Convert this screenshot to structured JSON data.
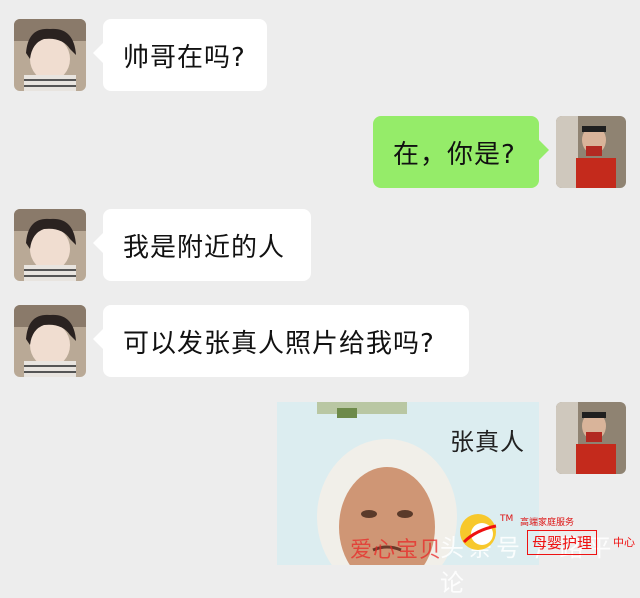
{
  "messages": [
    {
      "sender": "contact",
      "text": "帅哥在吗?"
    },
    {
      "sender": "self",
      "text": "在，你是?"
    },
    {
      "sender": "contact",
      "text": "我是附近的人"
    },
    {
      "sender": "contact",
      "text": "可以发张真人照片给我吗?"
    },
    {
      "sender": "self",
      "type": "sticker",
      "caption": "张真人"
    }
  ],
  "watermark": {
    "tm": "TM",
    "service": "高端家庭服务",
    "brand": "爱心宝贝",
    "center": "母婴护理",
    "suffix": "中心"
  },
  "overlay": "头条号 / 路平论",
  "colors": {
    "background": "#ededed",
    "incoming_bubble": "#ffffff",
    "outgoing_bubble": "#95ec69"
  }
}
